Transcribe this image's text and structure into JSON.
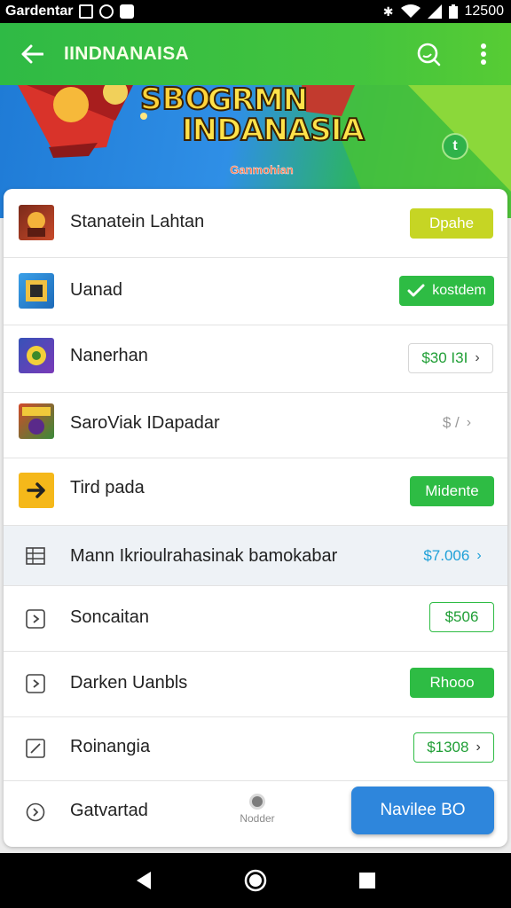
{
  "status_bar": {
    "carrier": "Gardentar",
    "time": "12500"
  },
  "app_bar": {
    "title": "IINDNANAISA",
    "back_icon": "arrow-left-icon",
    "search_icon": "search-icon",
    "more_icon": "more-vert-icon"
  },
  "banner": {
    "title_line1": "GRMN",
    "title_line2": "INDANASIA",
    "subtitle": "Ganmohian",
    "corner_text": "SBO",
    "fab_label": "t"
  },
  "list": [
    {
      "label": "Stanatein Lahtan",
      "action": "Dpahe",
      "action_style": "lime",
      "icon": "game-thumbnail-1"
    },
    {
      "label": "Uanad",
      "action": "kostdem",
      "action_style": "green-check",
      "icon": "game-thumbnail-2"
    },
    {
      "label": "Nanerhan",
      "action": "$30 I3I",
      "action_style": "outline-grey-chevron",
      "icon": "game-thumbnail-3"
    },
    {
      "label": "SaroViak IDapadar",
      "action": "$ /",
      "action_style": "ghost-chevron",
      "icon": "game-thumbnail-4"
    },
    {
      "label": "Tird pada",
      "action": "Midente",
      "action_style": "green",
      "icon": "arrow-right-icon"
    },
    {
      "label": "Mann Ikrioulrahasinak bamokabar",
      "action": "$7.006",
      "action_style": "link-chevron",
      "icon": "grid-icon"
    },
    {
      "label": "Soncaitan",
      "action": "$506",
      "action_style": "outline",
      "icon": "play-box-icon"
    },
    {
      "label": "Darken Uanbls",
      "action": "Rhooo",
      "action_style": "green",
      "icon": "play-box-icon"
    },
    {
      "label": "Roinangia",
      "action": "$1308",
      "action_style": "outline-chevron",
      "icon": "edit-icon"
    }
  ],
  "bottom": {
    "label": "Gatvartad",
    "icon": "clock-icon",
    "mid_label": "Nodder",
    "cta": "Navilee BO"
  },
  "colors": {
    "app_bar": "#3bbf42",
    "primary_green": "#2ebc44",
    "lime": "#c6d524",
    "link_blue": "#1ea0d8",
    "cta_blue": "#2e86dc"
  }
}
